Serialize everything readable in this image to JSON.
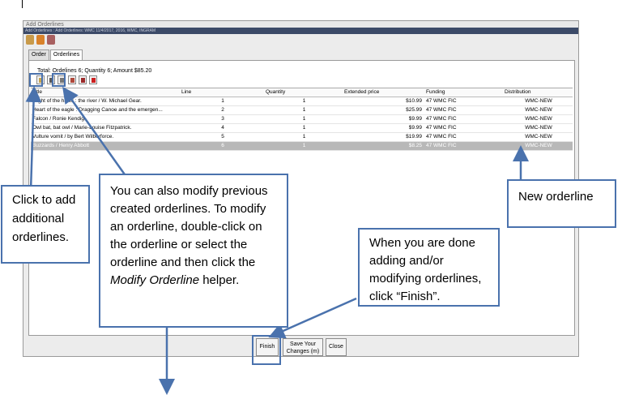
{
  "window": {
    "title": "Add Orderlines",
    "subtitle": "Add Orderlines : Add Orderlines: WMC 11/4/2017, 2016, WMC, INGRAM"
  },
  "tabs": [
    {
      "label": "Order",
      "active": false
    },
    {
      "label": "Orderlines",
      "active": true
    }
  ],
  "summary": "Total:  Ordelines 6;  Quantity 6;  Amount $85.20",
  "table": {
    "headers": [
      "Title",
      "Line",
      "Quantity",
      "Extended price",
      "Funding",
      "Distribution"
    ],
    "rows": [
      {
        "title": "Flight of the hawk : the river / W. Michael Gear.",
        "line": "1",
        "quantity": "1",
        "price": "$10.99",
        "funding": "47 WMC FIC",
        "distribution": "WMC-NEW",
        "selected": false
      },
      {
        "title": "Heart of the eagle : Dragging Canoe and the emergen...",
        "line": "2",
        "quantity": "1",
        "price": "$25.99",
        "funding": "47 WMC FIC",
        "distribution": "WMC-NEW",
        "selected": false
      },
      {
        "title": "Falcon / Ronie Kendig.",
        "line": "3",
        "quantity": "1",
        "price": "$9.99",
        "funding": "47 WMC FIC",
        "distribution": "WMC-NEW",
        "selected": false
      },
      {
        "title": "Owl bat, bat owl / Marie-Louise Fitzpatrick.",
        "line": "4",
        "quantity": "1",
        "price": "$9.99",
        "funding": "47 WMC FIC",
        "distribution": "WMC-NEW",
        "selected": false
      },
      {
        "title": "Vulture vomit / by Bert Wilberforce.",
        "line": "5",
        "quantity": "1",
        "price": "$19.99",
        "funding": "47 WMC FIC",
        "distribution": "WMC-NEW",
        "selected": false
      },
      {
        "title": "Buzzards / Henry Abbott",
        "line": "6",
        "quantity": "1",
        "price": "$8.25",
        "funding": "47 WMC FIC",
        "distribution": "WMC-NEW",
        "selected": true
      }
    ]
  },
  "buttons": {
    "finish": "Finish",
    "save": "Save Your Changes (m)",
    "close": "Close"
  },
  "callouts": {
    "add": "Click to add additional orderlines.",
    "modify_pre": "You can also modify previous created orderlines. To modify an orderline, double-click on the orderline or select the orderline and then click the ",
    "modify_em": "Modify Orderline",
    "modify_post": " helper.",
    "new": "New orderline",
    "finish": "When you are done adding and/or modifying orderlines, click “Finish”."
  },
  "colors": {
    "callout_border": "#4a72ad",
    "selected_row": "#b8b8b8",
    "title_bar": "#3c4a68"
  },
  "icons": [
    "add-orderline-icon",
    "modify-orderline-icon",
    "copy-icon",
    "notes-icon",
    "book-icon",
    "delete-icon"
  ]
}
